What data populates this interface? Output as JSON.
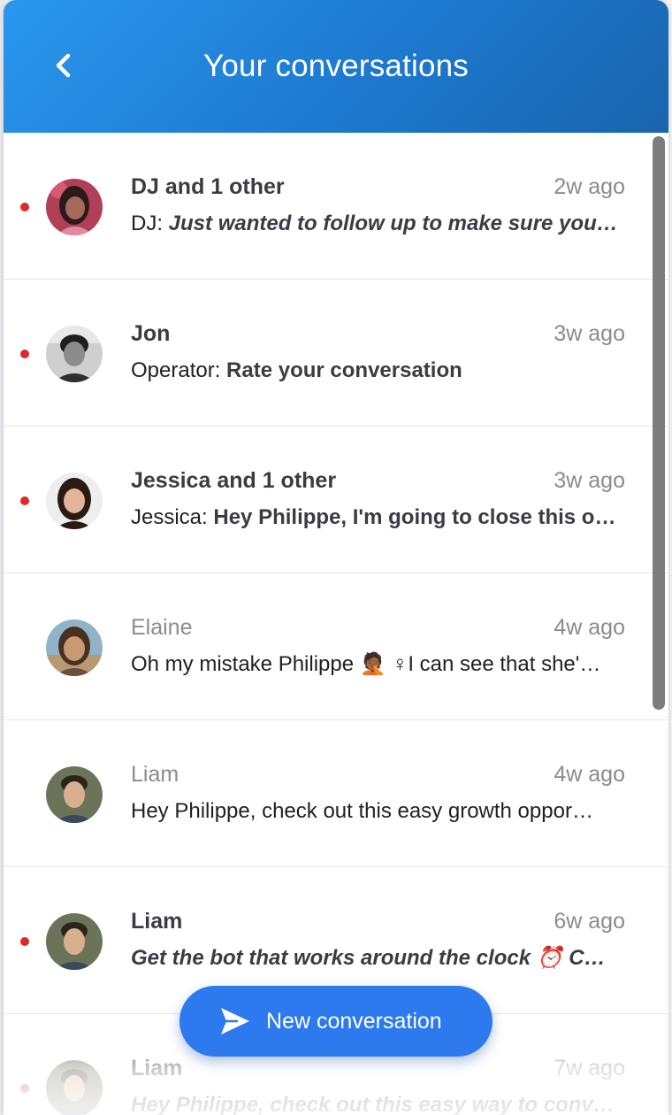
{
  "header": {
    "title": "Your conversations",
    "back_icon": "chevron-left-icon"
  },
  "conversations": [
    {
      "name": "DJ and 1 other",
      "time": "2w ago",
      "unread": true,
      "author": "DJ: ",
      "message": "Just wanted to follow up to make sure you…",
      "avatar_color": "#b04058"
    },
    {
      "name": "Jon",
      "time": "3w ago",
      "unread": true,
      "author": "Operator: ",
      "message": "Rate your conversation",
      "avatar_color": "#6a6a6a"
    },
    {
      "name": "Jessica and 1 other",
      "time": "3w ago",
      "unread": true,
      "author": "Jessica: ",
      "message": "Hey Philippe, I'm going to close this o…",
      "avatar_color": "#c89078"
    },
    {
      "name": "Elaine",
      "time": "4w ago",
      "unread": false,
      "author": "",
      "message": "Oh my mistake Philippe 🤦🏾 ♀I can see that she'…",
      "avatar_color": "#7a5a44"
    },
    {
      "name": "Liam",
      "time": "4w ago",
      "unread": false,
      "author": "",
      "message": "Hey Philippe, check out this easy growth oppor…",
      "avatar_color": "#5a6a50"
    },
    {
      "name": "Liam",
      "time": "6w ago",
      "unread": true,
      "author": "",
      "message": "Get the bot that works around the clock ⏰ C…",
      "avatar_color": "#5a6a50"
    },
    {
      "name": "Liam",
      "time": "7w ago",
      "unread": true,
      "author": "",
      "message": "Hey Philippe, check out this easy way to conv…",
      "avatar_color": "#5a6a50"
    }
  ],
  "new_conversation": {
    "label": "New conversation",
    "icon": "send-icon"
  },
  "colors": {
    "header_start": "#2a97ee",
    "header_end": "#1a64ac",
    "unread_dot": "#dc2a2a",
    "button": "#2d79ee"
  }
}
